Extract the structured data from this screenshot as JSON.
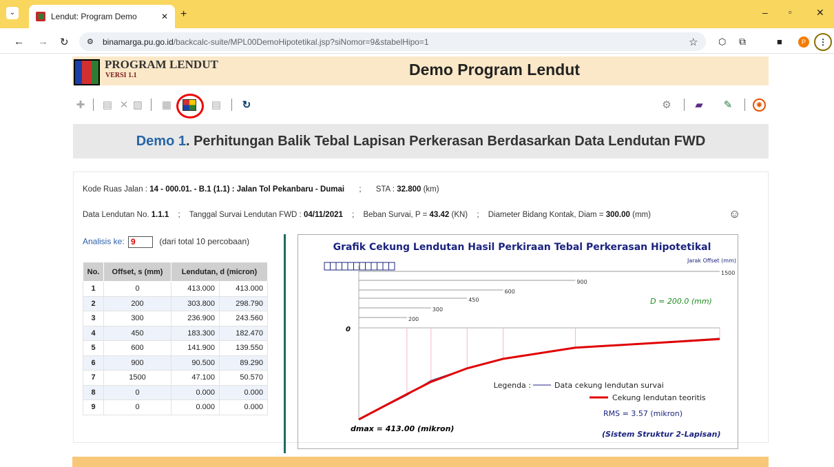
{
  "browser": {
    "tab_title": "Lendut: Program Demo",
    "url_host": "binamarga.pu.go.id",
    "url_path": "/backcalc-suite/MPL00DemoHipotetikal.jsp?siNomor=9&stabelHipo=1",
    "profile_initial": "P"
  },
  "header": {
    "brand": "PROGRAM LENDUT",
    "version": "VERSI 1.1",
    "title": "Demo Program Lendut"
  },
  "banner": {
    "demo": "Demo 1",
    "title": ". Perhitungan Balik Tebal Lapisan Perkerasan Berdasarkan Data Lendutan FWD"
  },
  "info": {
    "kode_label": "Kode Ruas Jalan :",
    "kode_value": "14 - 000.01. - B.1 (1.1) : Jalan Tol Pekanbaru - Dumai",
    "sep": ";",
    "sta_label": "STA :",
    "sta_value": "32.800",
    "sta_unit": "(km)",
    "data_label": "Data Lendutan No.",
    "data_value": "1.1.1",
    "tgl_label": "Tanggal Survai Lendutan FWD :",
    "tgl_value": "04/11/2021",
    "beban_label": "Beban Survai, P =",
    "beban_value": "43.42",
    "beban_unit": "(KN)",
    "diam_label": "Diameter Bidang Kontak, Diam =",
    "diam_value": "300.00",
    "diam_unit": "(mm)"
  },
  "analisis": {
    "label": "Analisis ke:",
    "value": "9",
    "note": "(dari total 10 percobaan)"
  },
  "table": {
    "headers": [
      "No.",
      "Offset, s (mm)",
      "Lendutan, d (micron)"
    ],
    "rows": [
      [
        "1",
        "0",
        "413.000",
        "413.000"
      ],
      [
        "2",
        "200",
        "303.800",
        "298.790"
      ],
      [
        "3",
        "300",
        "236.900",
        "243.560"
      ],
      [
        "4",
        "450",
        "183.300",
        "182.470"
      ],
      [
        "5",
        "600",
        "141.900",
        "139.550"
      ],
      [
        "6",
        "900",
        "90.500",
        "89.290"
      ],
      [
        "7",
        "1500",
        "47.100",
        "50.570"
      ],
      [
        "8",
        "0",
        "0.000",
        "0.000"
      ],
      [
        "9",
        "0",
        "0.000",
        "0.000"
      ]
    ]
  },
  "chart_data": {
    "type": "line",
    "title": "Grafik Cekung Lendutan Hasil Perkiraan Tebal Perkerasan Hipotetikal",
    "xlabel": "Jarak Offset (mm)",
    "x": [
      0,
      200,
      300,
      450,
      600,
      900,
      1500
    ],
    "offset_labels": [
      "200",
      "300",
      "450",
      "600",
      "900",
      "1500"
    ],
    "zero_label": "0",
    "series": [
      {
        "name": "Data cekung lendutan survai",
        "values": [
          413,
          303.8,
          236.9,
          183.3,
          141.9,
          90.5,
          47.1
        ],
        "color": "#6b6bb0"
      },
      {
        "name": "Cekung lendutan teoritis",
        "values": [
          413,
          298.79,
          243.56,
          182.47,
          139.55,
          89.29,
          50.57
        ],
        "color": "#e00000"
      }
    ],
    "legend_label": "Legenda :",
    "d_text": "D = 200.0 (mm)",
    "rms_text": "RMS = 3.57 (mikron)",
    "dmax_text": "dmax = 413.00 (mikron)",
    "system_text": "(Sistem Struktur 2-Lapisan)"
  }
}
